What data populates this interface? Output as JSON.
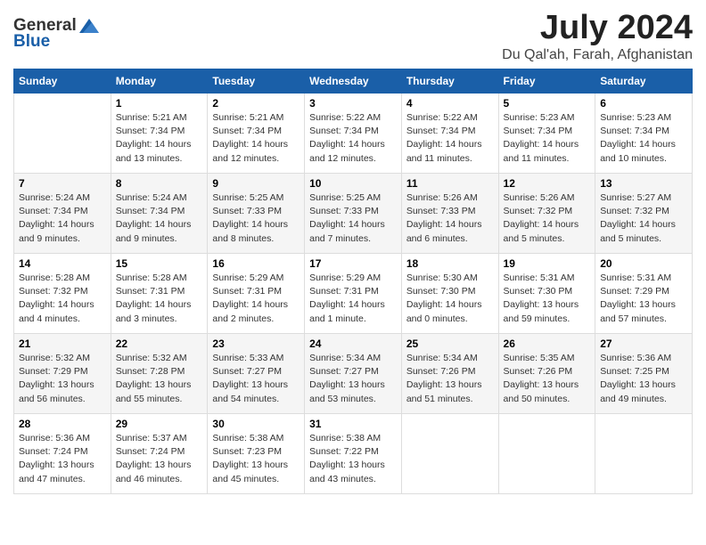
{
  "logo": {
    "general": "General",
    "blue": "Blue"
  },
  "title": "July 2024",
  "subtitle": "Du Qal'ah, Farah, Afghanistan",
  "days_header": [
    "Sunday",
    "Monday",
    "Tuesday",
    "Wednesday",
    "Thursday",
    "Friday",
    "Saturday"
  ],
  "weeks": [
    [
      {
        "day": "",
        "info": ""
      },
      {
        "day": "1",
        "info": "Sunrise: 5:21 AM\nSunset: 7:34 PM\nDaylight: 14 hours\nand 13 minutes."
      },
      {
        "day": "2",
        "info": "Sunrise: 5:21 AM\nSunset: 7:34 PM\nDaylight: 14 hours\nand 12 minutes."
      },
      {
        "day": "3",
        "info": "Sunrise: 5:22 AM\nSunset: 7:34 PM\nDaylight: 14 hours\nand 12 minutes."
      },
      {
        "day": "4",
        "info": "Sunrise: 5:22 AM\nSunset: 7:34 PM\nDaylight: 14 hours\nand 11 minutes."
      },
      {
        "day": "5",
        "info": "Sunrise: 5:23 AM\nSunset: 7:34 PM\nDaylight: 14 hours\nand 11 minutes."
      },
      {
        "day": "6",
        "info": "Sunrise: 5:23 AM\nSunset: 7:34 PM\nDaylight: 14 hours\nand 10 minutes."
      }
    ],
    [
      {
        "day": "7",
        "info": "Sunrise: 5:24 AM\nSunset: 7:34 PM\nDaylight: 14 hours\nand 9 minutes."
      },
      {
        "day": "8",
        "info": "Sunrise: 5:24 AM\nSunset: 7:34 PM\nDaylight: 14 hours\nand 9 minutes."
      },
      {
        "day": "9",
        "info": "Sunrise: 5:25 AM\nSunset: 7:33 PM\nDaylight: 14 hours\nand 8 minutes."
      },
      {
        "day": "10",
        "info": "Sunrise: 5:25 AM\nSunset: 7:33 PM\nDaylight: 14 hours\nand 7 minutes."
      },
      {
        "day": "11",
        "info": "Sunrise: 5:26 AM\nSunset: 7:33 PM\nDaylight: 14 hours\nand 6 minutes."
      },
      {
        "day": "12",
        "info": "Sunrise: 5:26 AM\nSunset: 7:32 PM\nDaylight: 14 hours\nand 5 minutes."
      },
      {
        "day": "13",
        "info": "Sunrise: 5:27 AM\nSunset: 7:32 PM\nDaylight: 14 hours\nand 5 minutes."
      }
    ],
    [
      {
        "day": "14",
        "info": "Sunrise: 5:28 AM\nSunset: 7:32 PM\nDaylight: 14 hours\nand 4 minutes."
      },
      {
        "day": "15",
        "info": "Sunrise: 5:28 AM\nSunset: 7:31 PM\nDaylight: 14 hours\nand 3 minutes."
      },
      {
        "day": "16",
        "info": "Sunrise: 5:29 AM\nSunset: 7:31 PM\nDaylight: 14 hours\nand 2 minutes."
      },
      {
        "day": "17",
        "info": "Sunrise: 5:29 AM\nSunset: 7:31 PM\nDaylight: 14 hours\nand 1 minute."
      },
      {
        "day": "18",
        "info": "Sunrise: 5:30 AM\nSunset: 7:30 PM\nDaylight: 14 hours\nand 0 minutes."
      },
      {
        "day": "19",
        "info": "Sunrise: 5:31 AM\nSunset: 7:30 PM\nDaylight: 13 hours\nand 59 minutes."
      },
      {
        "day": "20",
        "info": "Sunrise: 5:31 AM\nSunset: 7:29 PM\nDaylight: 13 hours\nand 57 minutes."
      }
    ],
    [
      {
        "day": "21",
        "info": "Sunrise: 5:32 AM\nSunset: 7:29 PM\nDaylight: 13 hours\nand 56 minutes."
      },
      {
        "day": "22",
        "info": "Sunrise: 5:32 AM\nSunset: 7:28 PM\nDaylight: 13 hours\nand 55 minutes."
      },
      {
        "day": "23",
        "info": "Sunrise: 5:33 AM\nSunset: 7:27 PM\nDaylight: 13 hours\nand 54 minutes."
      },
      {
        "day": "24",
        "info": "Sunrise: 5:34 AM\nSunset: 7:27 PM\nDaylight: 13 hours\nand 53 minutes."
      },
      {
        "day": "25",
        "info": "Sunrise: 5:34 AM\nSunset: 7:26 PM\nDaylight: 13 hours\nand 51 minutes."
      },
      {
        "day": "26",
        "info": "Sunrise: 5:35 AM\nSunset: 7:26 PM\nDaylight: 13 hours\nand 50 minutes."
      },
      {
        "day": "27",
        "info": "Sunrise: 5:36 AM\nSunset: 7:25 PM\nDaylight: 13 hours\nand 49 minutes."
      }
    ],
    [
      {
        "day": "28",
        "info": "Sunrise: 5:36 AM\nSunset: 7:24 PM\nDaylight: 13 hours\nand 47 minutes."
      },
      {
        "day": "29",
        "info": "Sunrise: 5:37 AM\nSunset: 7:24 PM\nDaylight: 13 hours\nand 46 minutes."
      },
      {
        "day": "30",
        "info": "Sunrise: 5:38 AM\nSunset: 7:23 PM\nDaylight: 13 hours\nand 45 minutes."
      },
      {
        "day": "31",
        "info": "Sunrise: 5:38 AM\nSunset: 7:22 PM\nDaylight: 13 hours\nand 43 minutes."
      },
      {
        "day": "",
        "info": ""
      },
      {
        "day": "",
        "info": ""
      },
      {
        "day": "",
        "info": ""
      }
    ]
  ]
}
